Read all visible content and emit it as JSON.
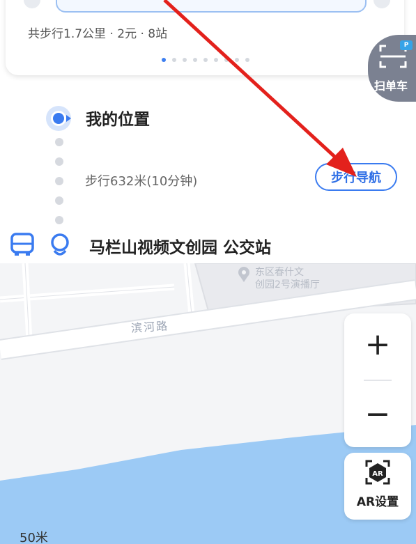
{
  "route_card": {
    "summary": "共步行1.7公里 · 2元 · 8站",
    "page_dots": 9,
    "active_dot": 0
  },
  "scan_bike": {
    "label": "扫单车",
    "icon": "scan-bike-icon"
  },
  "steps": {
    "start_label": "我的位置",
    "walk_info": "步行632米(10分钟)",
    "walk_nav_label": "步行导航",
    "stop_label": "马栏山视频文创园 公交站"
  },
  "map": {
    "poi_label_line1": "东区春什文",
    "poi_label_line2": "创园2号演播厅",
    "road_label": "滨河路",
    "zoom_in_label": "+",
    "zoom_out_label": "−",
    "ar_label": "AR设置",
    "scale_label": "50米"
  },
  "colors": {
    "accent": "#3a7bf0",
    "annotation_arrow": "#e3211c",
    "water": "#9ccaf5",
    "scan_bg": "#7b8191"
  }
}
